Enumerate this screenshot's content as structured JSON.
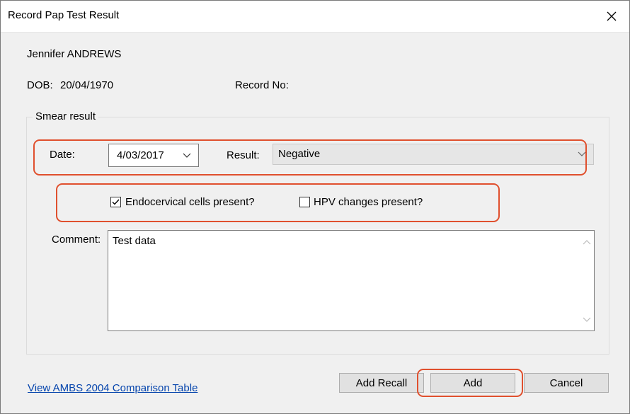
{
  "window": {
    "title": "Record Pap Test Result",
    "close_icon": "close-icon"
  },
  "patient": {
    "name": "Jennifer ANDREWS",
    "dob_label": "DOB:",
    "dob_value": "20/04/1970",
    "record_no_label": "Record No:"
  },
  "smear": {
    "legend": "Smear result",
    "date_label": "Date:",
    "date_value": "4/03/2017",
    "result_label": "Result:",
    "result_value": "Negative",
    "endocervical_label": "Endocervical cells present?",
    "endocervical_checked": true,
    "hpv_label": "HPV changes present?",
    "hpv_checked": false,
    "comment_label": "Comment:",
    "comment_value": "Test data"
  },
  "footer": {
    "link": "View AMBS 2004 Comparison Table",
    "add_recall": "Add Recall",
    "add": "Add",
    "cancel": "Cancel"
  },
  "colors": {
    "highlight": "#e0502e",
    "link": "#0645ad",
    "window_bg": "#f0f0f0"
  }
}
